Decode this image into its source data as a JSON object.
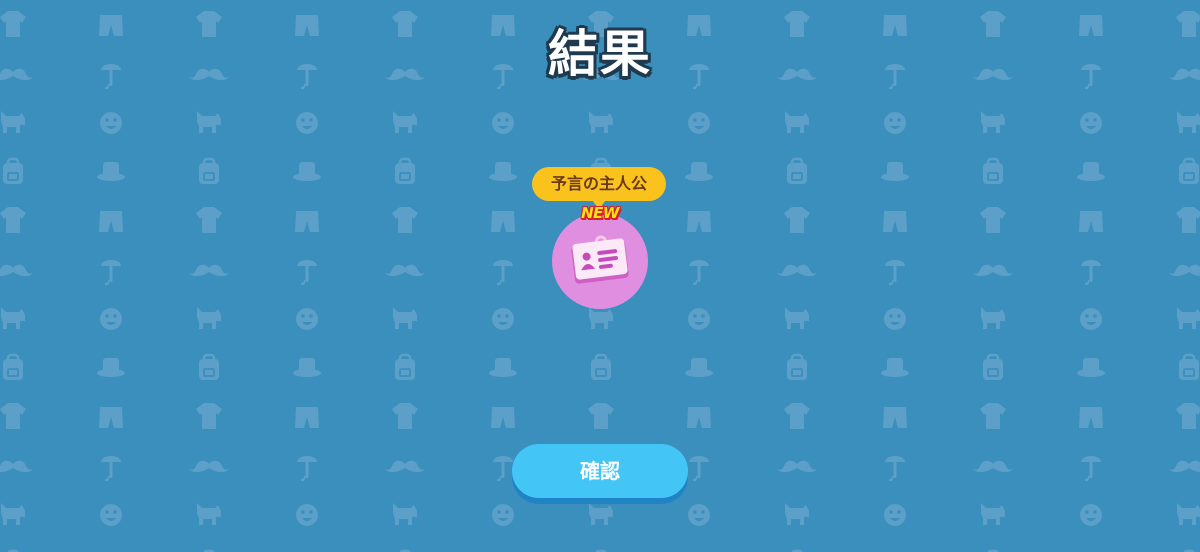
{
  "screen": {
    "title": "結果",
    "background_color": "#3a8fbd",
    "pattern_icons": [
      "shirt-icon",
      "shorts-icon",
      "mustache-icon",
      "umbrella-icon",
      "dog-icon",
      "smiley-icon",
      "backpack-icon",
      "hat-icon"
    ]
  },
  "reward": {
    "name": "予言の主人公",
    "badge": "NEW",
    "icon": "id-card-icon",
    "circle_color": "#e08ee0"
  },
  "confirm_button": {
    "label": "確認",
    "color": "#43c6f5"
  }
}
